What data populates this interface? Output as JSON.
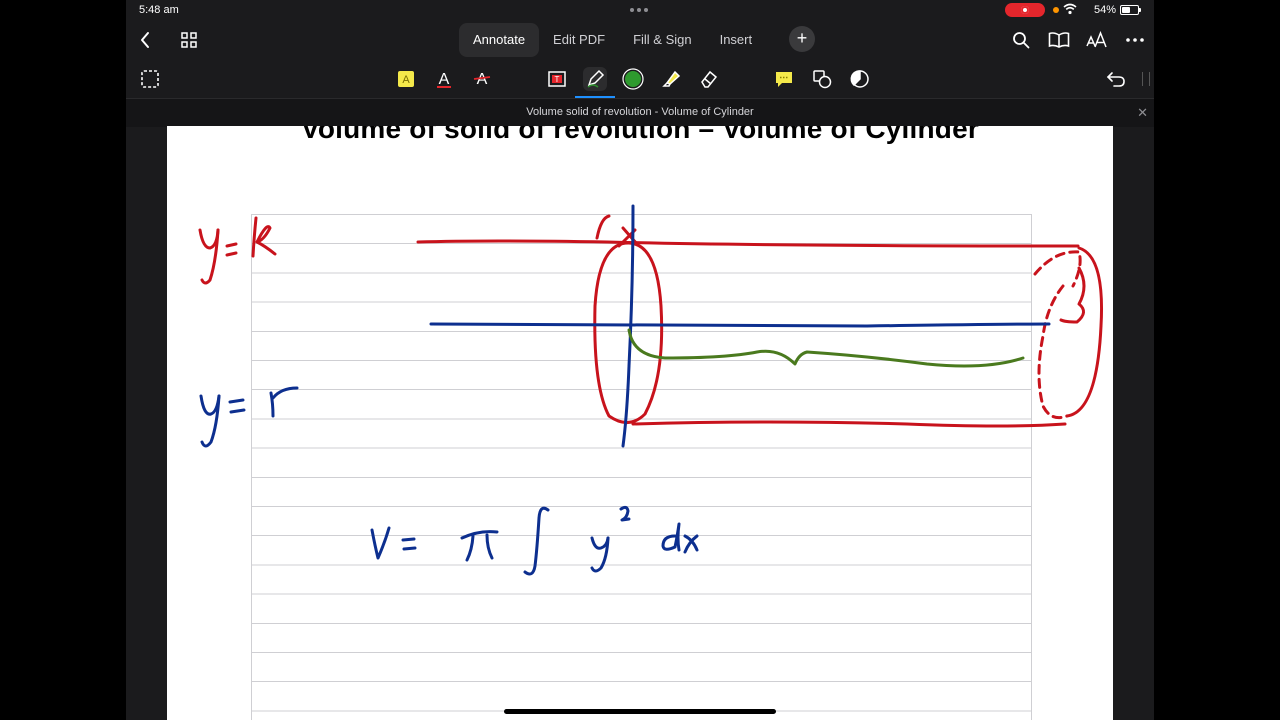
{
  "status": {
    "time": "5:48 am",
    "battery": "54%"
  },
  "tabs": [
    {
      "label": "Annotate"
    },
    {
      "label": "Edit PDF"
    },
    {
      "label": "Fill & Sign"
    },
    {
      "label": "Insert"
    }
  ],
  "document": {
    "title": "Volume solid of revolution - Volume of Cylinder",
    "heading": "Volume of solid of revolution – Volume of Cylinder"
  },
  "handwriting": {
    "red_label": "y = k",
    "blue_label": "y = r",
    "formula": "V = π ∫ y² dx"
  },
  "colors": {
    "ink_red": "#c8131c",
    "ink_blue": "#0d2f8f",
    "ink_green": "#4a7a1e",
    "accent": "#1e90ff",
    "highlight": "#f4e94a"
  },
  "icons": {
    "toolbar": [
      "select-icon",
      "highlight-color-icon",
      "text-color-icon",
      "strikethrough-icon",
      "text-box-icon",
      "pen-icon",
      "color-picker-icon",
      "highlighter-icon",
      "eraser-icon",
      "comment-icon",
      "shapes-icon",
      "stamp-icon",
      "undo-icon"
    ]
  }
}
